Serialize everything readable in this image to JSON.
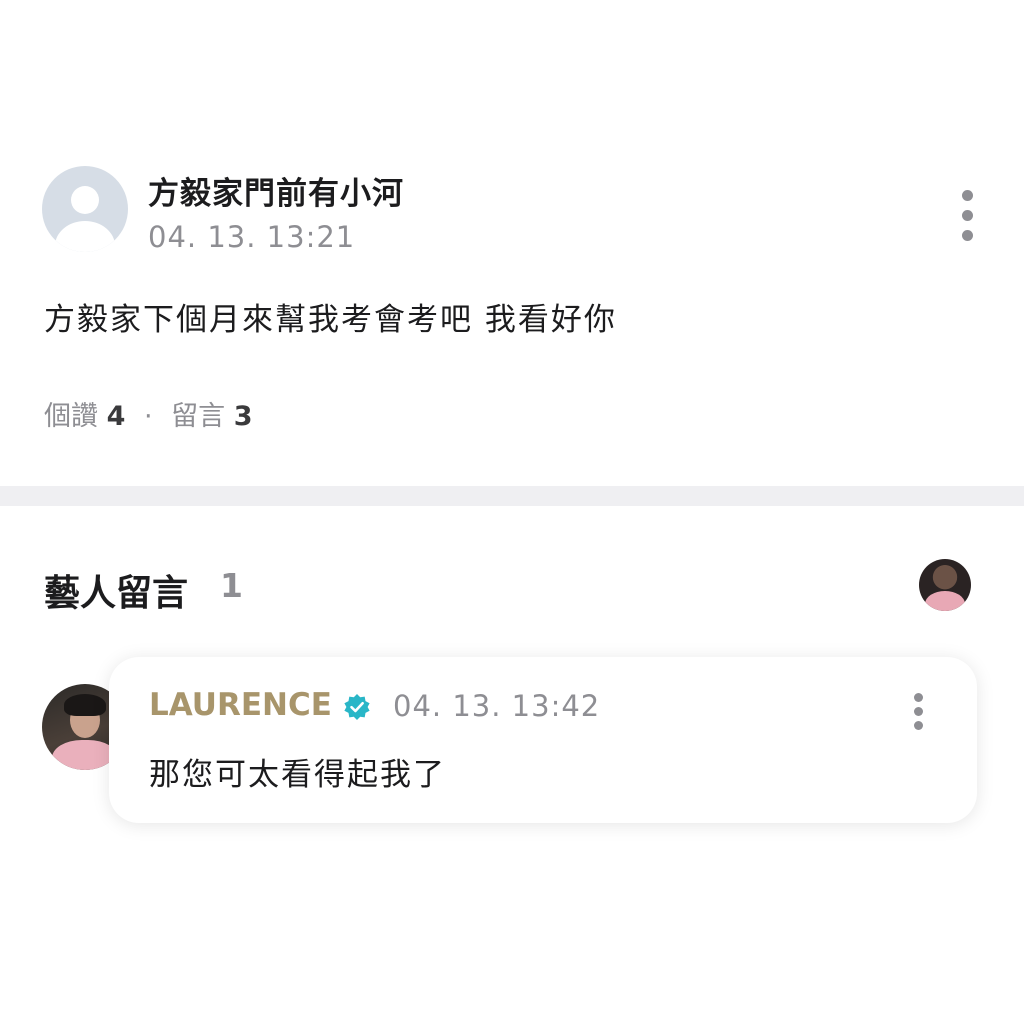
{
  "post": {
    "author_name": "方毅家門前有小河",
    "timestamp": "04. 13. 13:21",
    "body": "方毅家下個月來幫我考會考吧 我看好你",
    "likes_label": "個讚",
    "likes_count": "4",
    "separator": "·",
    "comments_label": "留言",
    "comments_count": "3"
  },
  "artist_comments": {
    "title": "藝人留言",
    "count": "1",
    "items": [
      {
        "author": "LAURENCE",
        "verified": true,
        "timestamp": "04. 13. 13:42",
        "text": "那您可太看得起我了"
      }
    ]
  },
  "icons": {
    "post_more": "more-vertical-icon",
    "comment_more": "more-vertical-icon",
    "verified": "verified-badge-icon",
    "default_avatar": "default-avatar-icon"
  },
  "colors": {
    "artist_name": "#a8956b",
    "verified_badge": "#29b6c7",
    "secondary_text": "#8e8e93",
    "divider": "#efeff2"
  }
}
